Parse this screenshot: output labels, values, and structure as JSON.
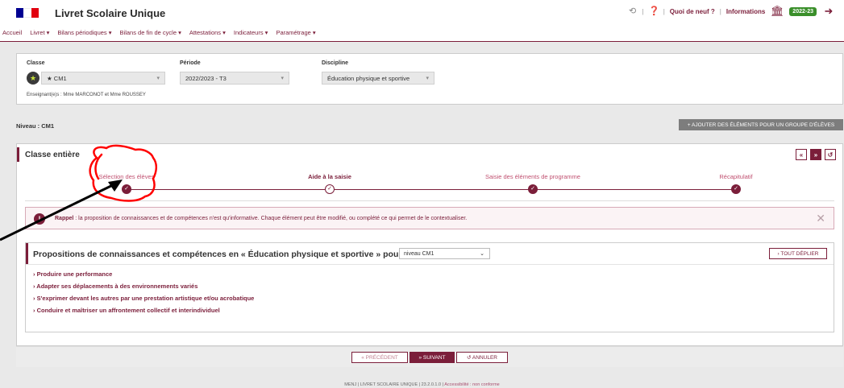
{
  "header": {
    "app_title": "Livret Scolaire Unique",
    "quoi_de_neuf": "Quoi de neuf ?",
    "informations": "Informations",
    "year_badge": "2022-23",
    "icons": [
      "refresh-icon",
      "help-icon",
      "institution-icon",
      "logout-icon"
    ],
    "flag_colors": [
      "#000091",
      "#ffffff",
      "#e1000f"
    ]
  },
  "menu": {
    "items": [
      {
        "label": "Accueil"
      },
      {
        "label": "Livret ▾"
      },
      {
        "label": "Bilans périodiques ▾"
      },
      {
        "label": "Bilans de fin de cycle ▾"
      },
      {
        "label": "Attestations ▾"
      },
      {
        "label": "Indicateurs ▾"
      },
      {
        "label": "Paramétrage ▾"
      }
    ]
  },
  "filters": {
    "classe_label": "Classe",
    "classe_value": "★ CM1",
    "periode_label": "Période",
    "periode_value": "2022/2023 - T3",
    "discipline_label": "Discipline",
    "discipline_value": "Éducation physique et sportive",
    "teachers": "Enseignant(e)s : Mme MARCONOT et Mme ROUSSEY"
  },
  "niveau": "Niveau : CM1",
  "add_group_button": "+ AJOUTER DES ÉLÉMENTS POUR UN GROUPE D'ÉLÈVES",
  "main": {
    "title": "Classe entière",
    "buttons": [
      "«",
      "»",
      "↺"
    ],
    "steps": [
      {
        "label": "Sélection des élèves",
        "active": false
      },
      {
        "label": "Aide à la saisie",
        "active": true
      },
      {
        "label": "Saisie des éléments de programme",
        "active": false
      },
      {
        "label": "Récapitulatif",
        "active": false
      }
    ],
    "rappel_bold": "Rappel",
    "rappel_text": " : la proposition de connaissances et de compétences n'est qu'informative. Chaque élément peut être modifié, ou complété ce qui permet de le contextualiser.",
    "props_title": "Propositions de connaissances et compétences en « Éducation physique et sportive » pour le",
    "niveau_select": "niveau CM1",
    "deplier_button": "› TOUT DÉPLIER",
    "propositions": [
      "› Produire une performance",
      "› Adapter ses déplacements à des environnements variés",
      "› S'exprimer devant les autres par une prestation artistique et/ou acrobatique",
      "› Conduire et maîtriser un affrontement collectif et interindividuel"
    ]
  },
  "footer": {
    "prev": "« PRÉCÉDENT",
    "next": "» SUIVANT",
    "cancel": "↺ ANNULER",
    "legal": "MENJ  |  LIVRET SCOLAIRE UNIQUE  |  23.2.0.1.0  |  ",
    "accessibility": "Accessibilité : non conforme"
  },
  "colors": {
    "accent": "#7b1e3a",
    "annotation": "#ff0000",
    "badge": "#3a8f2a"
  }
}
